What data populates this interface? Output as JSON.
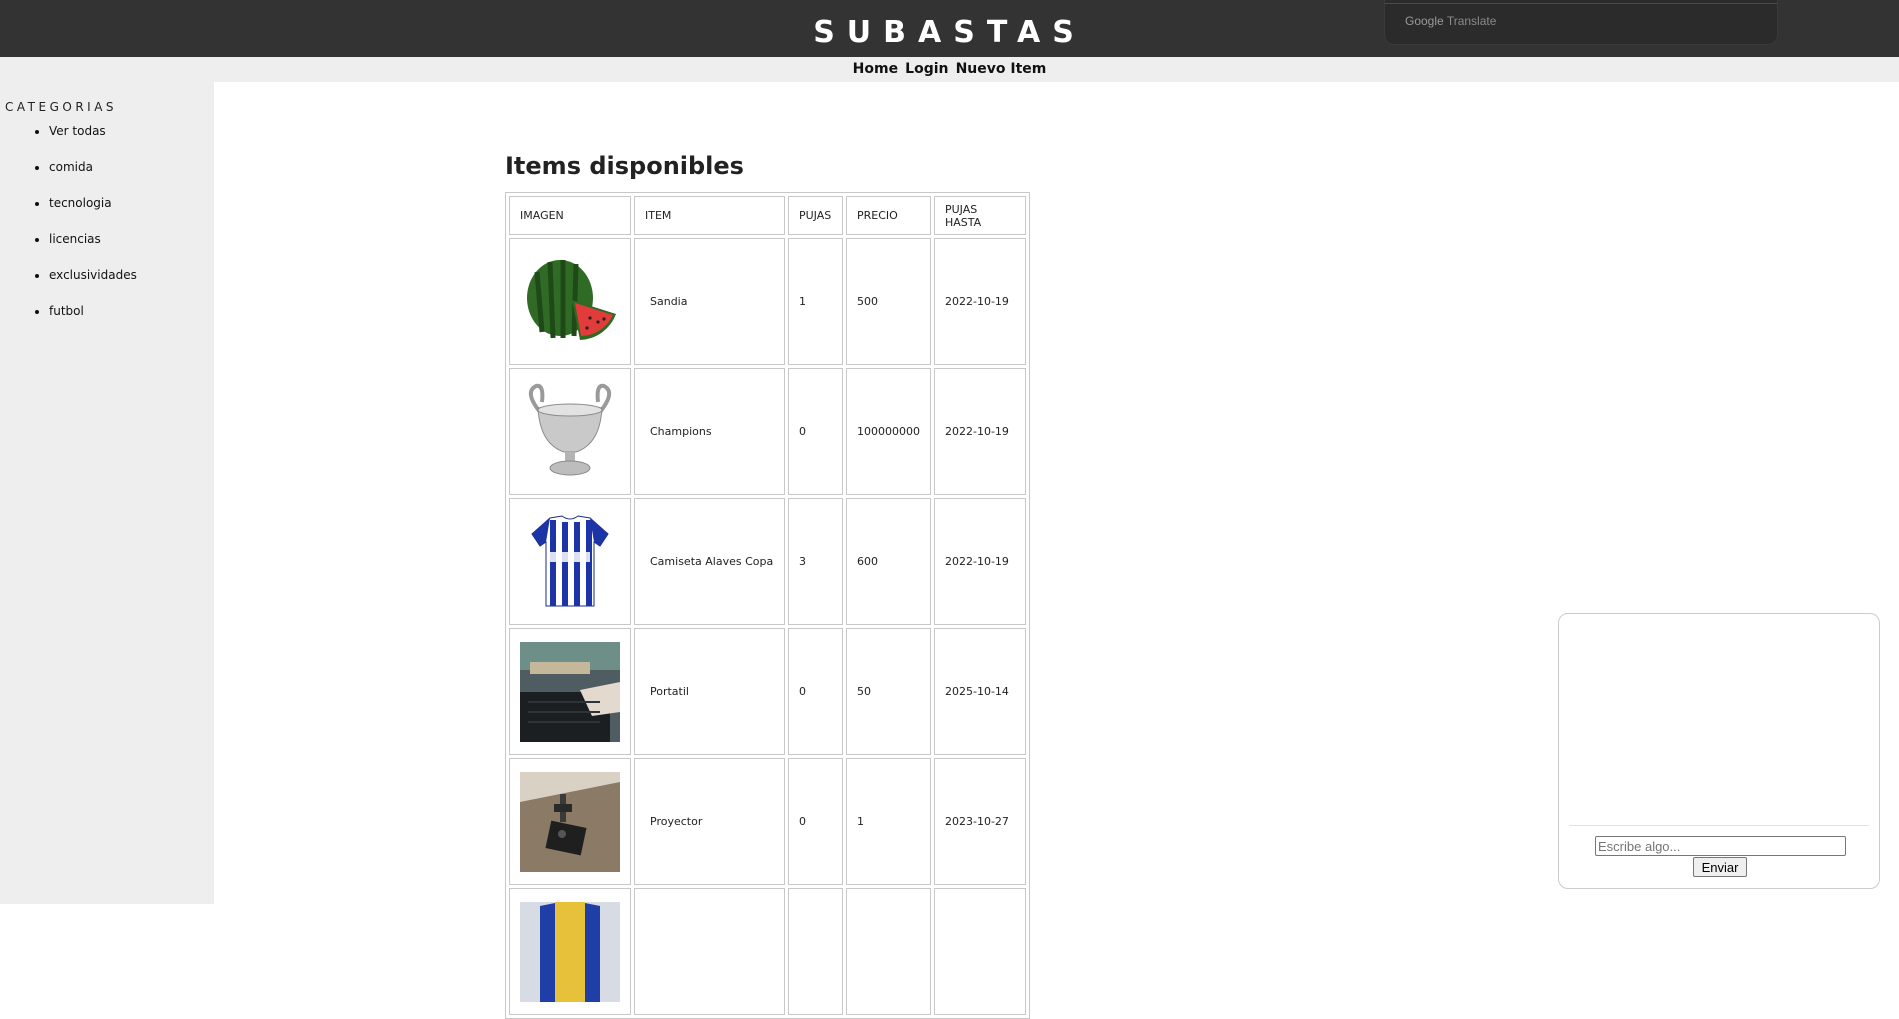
{
  "header": {
    "title": "SUBASTAS"
  },
  "google_translate": {
    "brand": "Google",
    "label": "Translate"
  },
  "nav": {
    "links": [
      "Home",
      "Login",
      "Nuevo Item"
    ]
  },
  "sidebar": {
    "title": "CATEGORIAS",
    "items": [
      "Ver todas",
      "comida",
      "tecnologia",
      "licencias",
      "exclusividades",
      "futbol"
    ]
  },
  "main": {
    "title": "Items disponibles",
    "table": {
      "headers": [
        "IMAGEN",
        "ITEM",
        "PUJAS",
        "PRECIO",
        "PUJAS HASTA"
      ],
      "rows": [
        {
          "image": "watermelon",
          "item": "Sandia",
          "pujas": "1",
          "precio": "500",
          "hasta": "2022-10-19"
        },
        {
          "image": "champions-trophy",
          "item": "Champions",
          "pujas": "0",
          "precio": "100000000",
          "hasta": "2022-10-19"
        },
        {
          "image": "football-shirt",
          "item": "Camiseta Alaves Copa",
          "pujas": "3",
          "precio": "600",
          "hasta": "2022-10-19"
        },
        {
          "image": "laptop",
          "item": "Portatil",
          "pujas": "0",
          "precio": "50",
          "hasta": "2025-10-14"
        },
        {
          "image": "projector",
          "item": "Proyector",
          "pujas": "0",
          "precio": "1",
          "hasta": "2023-10-27"
        }
      ]
    }
  },
  "chat": {
    "placeholder": "Escribe algo...",
    "send_label": "Enviar"
  },
  "colors": {
    "header_bg": "#333333",
    "sidebar_bg": "#eeeeee",
    "border": "#c8c8c8"
  }
}
